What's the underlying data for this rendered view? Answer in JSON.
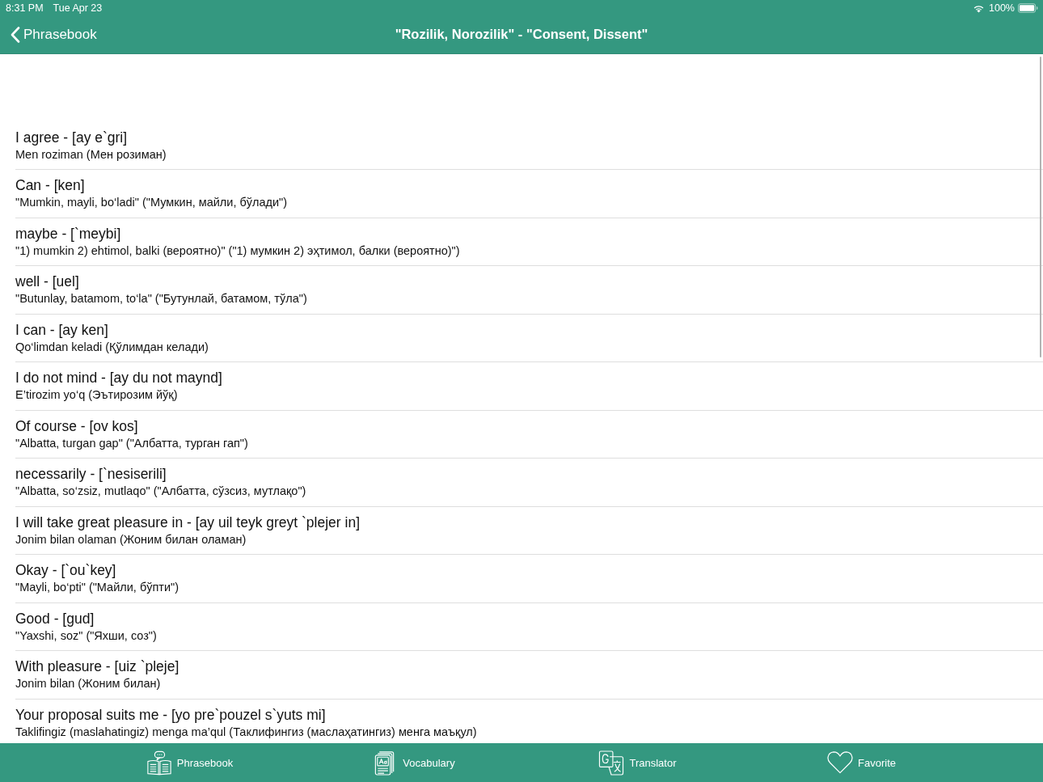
{
  "status_bar": {
    "time": "8:31 PM",
    "date": "Tue Apr 23",
    "battery": "100%"
  },
  "nav_bar": {
    "back": "Phrasebook",
    "title": "\"Rozilik, Norozilik\" - \"Consent, Dissent\""
  },
  "phrases": [
    {
      "title": "I agree - [ay e`gri]",
      "translation": "Men roziman (Мен розиман)"
    },
    {
      "title": "Can - [ken]",
      "translation": "\"Mumkin, mayli, bo‘ladi\" (\"Мумкин, майли, бўлади\")"
    },
    {
      "title": "maybe - [`meybi]",
      "translation": "\"1) mumkin 2) ehtimol, balki (вероятно)\" (\"1) мумкин 2) эҳтимол, балки (вероятно)\")"
    },
    {
      "title": "well - [uel]",
      "translation": "\"Butunlay, batamom, to‘la\" (\"Бутунлай, батамом, тўла\")"
    },
    {
      "title": "I can - [ay ken]",
      "translation": "Qo‘limdan keladi (Қўлимдан келади)"
    },
    {
      "title": "I do not mind - [ay du not maynd]",
      "translation": "E’tirozim yo‘q (Эътирозим йўқ)"
    },
    {
      "title": "Of course - [ov kos]",
      "translation": "\"Albatta, turgan gap\" (\"Албатта, турган гап\")"
    },
    {
      "title": "necessarily - [`nesiserili]",
      "translation": "\"Albatta, so‘zsiz, mutlaqo\" (\"Албатта, сўзсиз, мутлақо\")"
    },
    {
      "title": "I will take great pleasure in - [ay uil teyk greyt `plejer in]",
      "translation": "Jonim bilan olaman (Жоним билан оламан)"
    },
    {
      "title": "Okay - [`ou`key]",
      "translation": "\"Mayli, bo‘pti\" (\"Майли, бўпти\")"
    },
    {
      "title": "Good - [gud]",
      "translation": "\"Yaxshi, soz\" (\"Яхши, соз\")"
    },
    {
      "title": "With pleasure - [uiz `pleje]",
      "translation": "Jonim bilan (Жоним билан)"
    },
    {
      "title": "Your proposal suits me - [yo pre`pouzel s`yuts mi]",
      "translation": "Taklifingiz (maslahatingiz) menga ma’qul (Таклифингиз (маслаҳатингиз) менга маъқул)"
    }
  ],
  "tab_bar": {
    "items": [
      {
        "label": "Phrasebook",
        "kind": "phrasebook"
      },
      {
        "label": "Vocabulary",
        "kind": "vocabulary"
      },
      {
        "label": "Translator",
        "kind": "translator"
      },
      {
        "label": "Favorite",
        "kind": "favorite"
      }
    ]
  }
}
